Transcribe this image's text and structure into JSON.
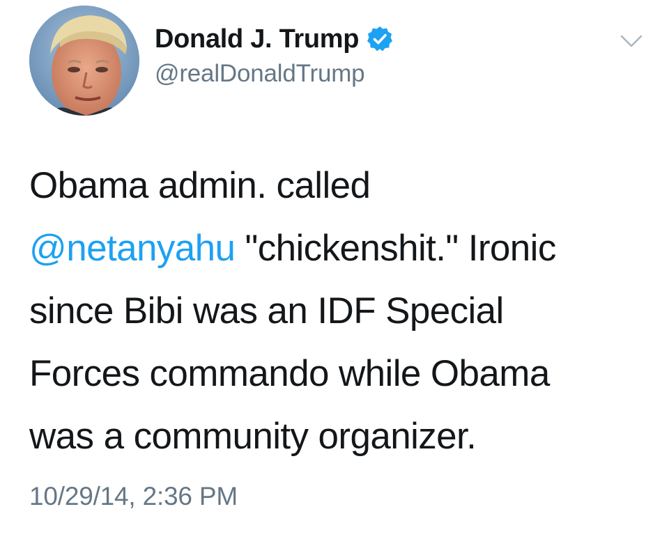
{
  "author": {
    "display_name": "Donald J. Trump",
    "handle": "@realDonaldTrump",
    "verified": true
  },
  "tweet": {
    "line1": "Obama admin. called",
    "mention": "@netanyahu",
    "line2_rest": " \"chickenshit.\" Ironic",
    "line3": "since Bibi was an IDF Special",
    "line4": "Forces commando while Obama",
    "line5": "was a community organizer."
  },
  "timestamp": "10/29/14, 2:36 PM",
  "icons": {
    "verified": "verified-badge-icon",
    "menu": "chevron-down-icon"
  },
  "colors": {
    "accent": "#1da1f2",
    "text": "#14171a",
    "muted": "#657786"
  }
}
